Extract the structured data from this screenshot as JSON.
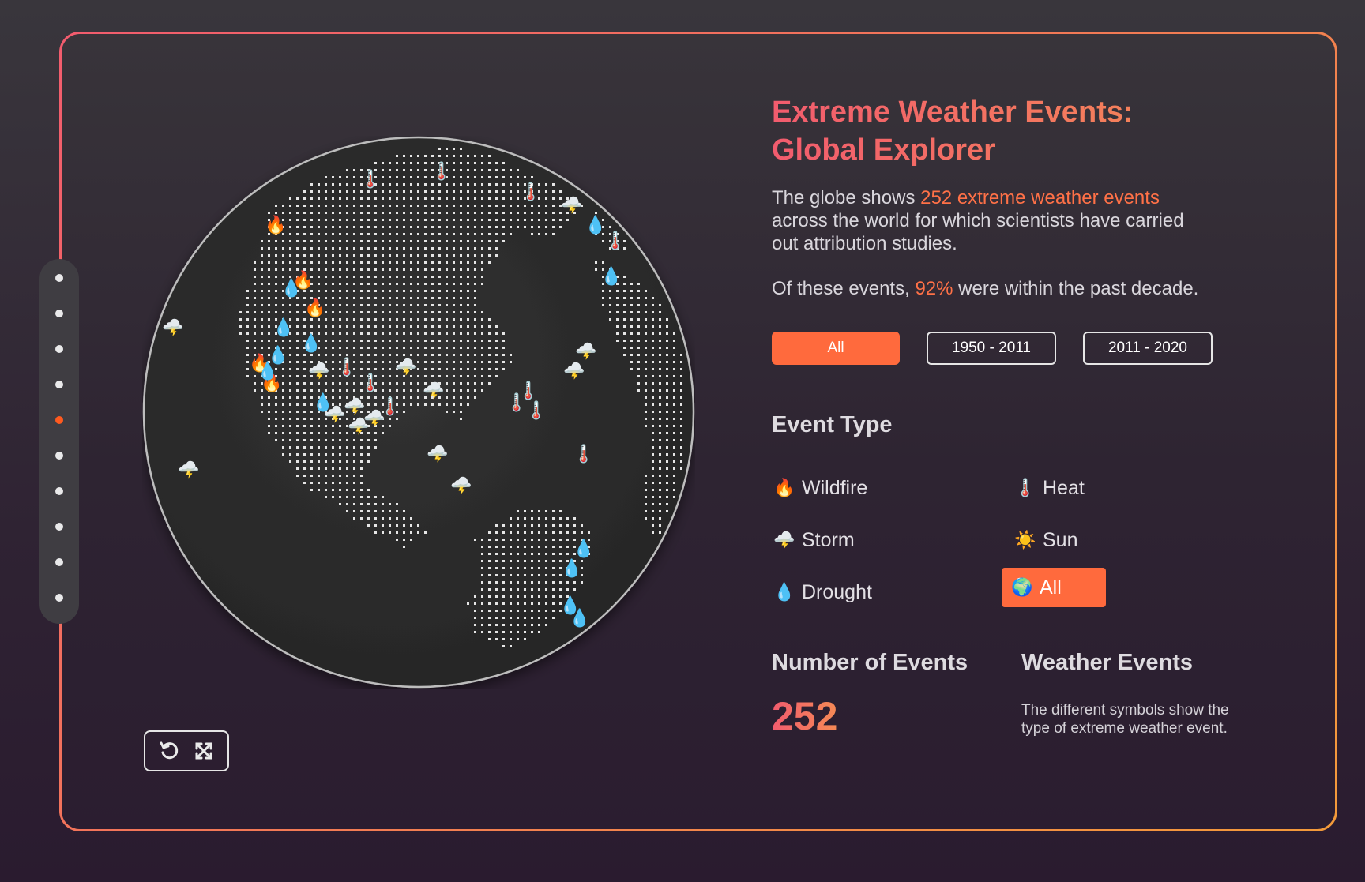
{
  "title": {
    "line1": "Extreme Weather Events:",
    "line2": "Global Explorer"
  },
  "intro": {
    "prefix": "The globe shows ",
    "highlight": "252 extreme weather events",
    "suffix": " across the world for which scientists have carried out attribution studies."
  },
  "decade": {
    "prefix": "Of these events, ",
    "highlight": "92%",
    "suffix": " were within the past decade."
  },
  "periods": [
    {
      "label": "All",
      "active": true
    },
    {
      "label": "1950 - 2011",
      "active": false
    },
    {
      "label": "2011 - 2020",
      "active": false
    }
  ],
  "event_type": {
    "heading": "Event Type",
    "items": [
      {
        "label": "Wildfire",
        "icon": "🔥",
        "icon_name": "fire-icon",
        "active": false
      },
      {
        "label": "Heat",
        "icon": "🌡️",
        "icon_name": "thermometer-icon",
        "active": false
      },
      {
        "label": "Storm",
        "icon": "🌩️",
        "icon_name": "storm-cloud-icon",
        "active": false
      },
      {
        "label": "Sun",
        "icon": "☀️",
        "icon_name": "sun-icon",
        "active": false
      },
      {
        "label": "Drought",
        "icon": "💧",
        "icon_name": "droplet-icon",
        "active": false
      },
      {
        "label": "All",
        "icon": "🌍",
        "icon_name": "globe-icon",
        "active": true
      }
    ]
  },
  "stats": {
    "count_heading": "Number of Events",
    "count_value": "252",
    "legend_heading": "Weather Events",
    "legend_text": "The different symbols show the type of extreme weather event."
  },
  "slider": {
    "steps": 10,
    "active_index": 4
  },
  "controls": {
    "reset_icon": "rotate-ccw-icon",
    "expand_icon": "expand-arrows-icon"
  },
  "colors": {
    "accent": "#ff6a3d",
    "gradient_start": "#f25c6e",
    "gradient_end": "#f39a3a",
    "globe_fill": "#2b2b2b",
    "land_dots": "#ffffff"
  }
}
